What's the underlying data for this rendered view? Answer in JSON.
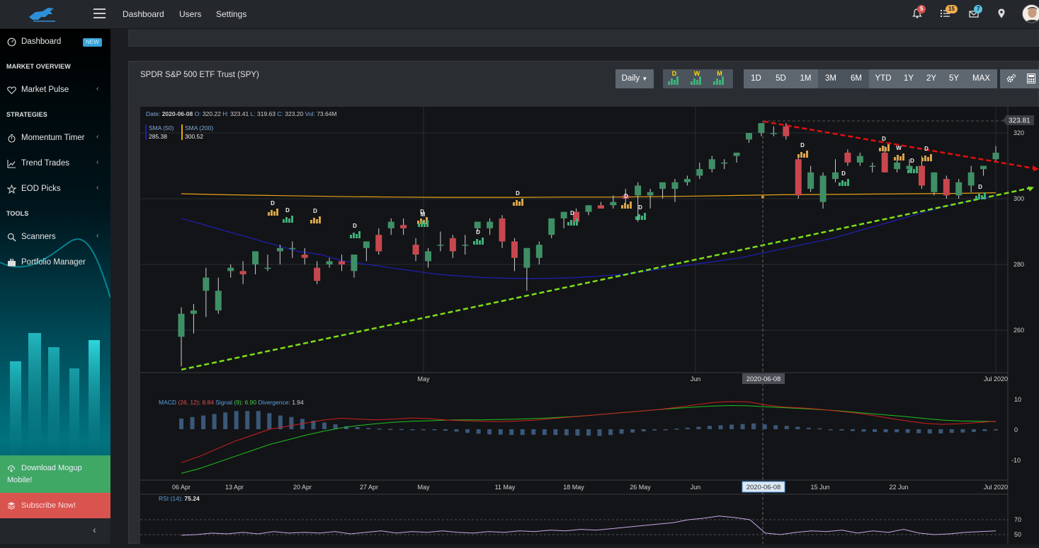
{
  "topbar": {
    "nav": [
      "Dashboard",
      "Users",
      "Settings"
    ],
    "badges": {
      "notifications": "5",
      "tasks": "15",
      "messages": "7"
    },
    "colors": {
      "notifications": "#d9534f",
      "tasks": "#f0ad4e",
      "messages": "#5bc0de"
    }
  },
  "sidebar": {
    "dashboard": "Dashboard",
    "new_badge": "NEW",
    "market_overview": "MARKET OVERVIEW",
    "market_pulse": "Market Pulse",
    "strategies": "STRATEGIES",
    "momentum_timer": "Momentum Timer",
    "trend_trades": "Trend Trades",
    "eod_picks": "EOD Picks",
    "tools": "TOOLS",
    "scanners": "Scanners",
    "portfolio_manager": "Portfolio Manager",
    "download_line1": "Download Mogup",
    "download_line2": "Mobile!",
    "subscribe": "Subscribe Now!"
  },
  "panel": {
    "title": "SPDR S&P 500 ETF Trust (SPY)",
    "interval": "Daily",
    "period_icons": [
      "D",
      "W",
      "M"
    ],
    "ranges": [
      "1D",
      "5D",
      "1M",
      "3M",
      "6M",
      "YTD",
      "1Y",
      "2Y",
      "5Y",
      "MAX"
    ],
    "active_ranges": [
      "3M",
      "6M"
    ]
  },
  "chart": {
    "info": {
      "date_label": "Date:",
      "date": "2020-06-08",
      "o_label": "O:",
      "o": "320.22",
      "h_label": "H:",
      "h": "323.41",
      "l_label": "L:",
      "l": "319.63",
      "c_label": "C:",
      "c": "323.20",
      "vol_label": "Vol:",
      "vol": "73.64M"
    },
    "sma50_label": "SMA (50)",
    "sma50_value": "285.38",
    "sma200_label": "SMA (200)",
    "sma200_value": "300.52",
    "last_price": "323.81",
    "price_ticks": [
      "320",
      "300",
      "280",
      "260"
    ],
    "month_labels": [
      "May",
      "Jun",
      "Jul 2020"
    ],
    "crosshair_date": "2020-06-08",
    "macd": {
      "name": "MACD",
      "params": "(26, 12)",
      "value": "8.84",
      "signal_label": "Signal",
      "signal_params": "(9)",
      "signal_value": "6.90",
      "divergence_label": "Divergence",
      "divergence_value": "1.94",
      "ticks": [
        "10",
        "0",
        "-10"
      ]
    },
    "date_ticks": [
      "06 Apr",
      "13 Apr",
      "20 Apr",
      "27 Apr",
      "May",
      "11 May",
      "18 May",
      "26 May",
      "Jun",
      "15 Jun",
      "22 Jun",
      "Jul 2020"
    ],
    "rsi": {
      "label": "RSI",
      "params": "(14)",
      "value": "75.24",
      "ticks": [
        "70",
        "50"
      ]
    },
    "colors": {
      "up": "#3f8f66",
      "down": "#c8474f",
      "sma50": "#1f1fb8",
      "sma200": "#e8a317",
      "support": "#7be018",
      "resistance": "#e01010"
    }
  },
  "chart_data": {
    "type": "candlestick",
    "symbol": "SPY",
    "interval": "Daily",
    "ylim": [
      248,
      332
    ],
    "candles": [
      {
        "o": 258,
        "h": 267,
        "l": 249,
        "c": 265
      },
      {
        "o": 265,
        "h": 268,
        "l": 259,
        "c": 266
      },
      {
        "o": 272,
        "h": 279,
        "l": 264,
        "c": 276
      },
      {
        "o": 266,
        "h": 276,
        "l": 265,
        "c": 272
      },
      {
        "o": 278,
        "h": 280,
        "l": 276,
        "c": 279
      },
      {
        "o": 278,
        "h": 281,
        "l": 274,
        "c": 277
      },
      {
        "o": 280,
        "h": 284,
        "l": 277,
        "c": 284
      },
      {
        "o": 279,
        "h": 283,
        "l": 278,
        "c": 279
      },
      {
        "o": 284,
        "h": 286,
        "l": 280,
        "c": 285
      },
      {
        "o": 285,
        "h": 287,
        "l": 282,
        "c": 285
      },
      {
        "o": 283,
        "h": 285,
        "l": 280,
        "c": 282
      },
      {
        "o": 279,
        "h": 281,
        "l": 274,
        "c": 275
      },
      {
        "o": 280,
        "h": 282,
        "l": 279,
        "c": 281
      },
      {
        "o": 281,
        "h": 283,
        "l": 278,
        "c": 280
      },
      {
        "o": 278,
        "h": 283,
        "l": 276,
        "c": 283
      },
      {
        "o": 285,
        "h": 287,
        "l": 281,
        "c": 287
      },
      {
        "o": 289,
        "h": 291,
        "l": 283,
        "c": 284
      },
      {
        "o": 291,
        "h": 294,
        "l": 289,
        "c": 293
      },
      {
        "o": 292,
        "h": 294,
        "l": 289,
        "c": 291
      },
      {
        "o": 286,
        "h": 288,
        "l": 281,
        "c": 283
      },
      {
        "o": 281,
        "h": 285,
        "l": 279,
        "c": 284
      },
      {
        "o": 286,
        "h": 290,
        "l": 284,
        "c": 286
      },
      {
        "o": 288,
        "h": 289,
        "l": 282,
        "c": 284
      },
      {
        "o": 286,
        "h": 289,
        "l": 283,
        "c": 286
      },
      {
        "o": 291,
        "h": 293,
        "l": 290,
        "c": 293
      },
      {
        "o": 291,
        "h": 294,
        "l": 289,
        "c": 293
      },
      {
        "o": 294,
        "h": 295,
        "l": 285,
        "c": 287
      },
      {
        "o": 287,
        "h": 288,
        "l": 278,
        "c": 282
      },
      {
        "o": 279,
        "h": 284,
        "l": 272,
        "c": 285
      },
      {
        "o": 282,
        "h": 287,
        "l": 280,
        "c": 286
      },
      {
        "o": 289,
        "h": 294,
        "l": 288,
        "c": 294
      },
      {
        "o": 294,
        "h": 296,
        "l": 291,
        "c": 296
      },
      {
        "o": 296,
        "h": 297,
        "l": 292,
        "c": 293
      },
      {
        "o": 296,
        "h": 298,
        "l": 295,
        "c": 298
      },
      {
        "o": 298,
        "h": 299,
        "l": 297,
        "c": 297
      },
      {
        "o": 298,
        "h": 301,
        "l": 297,
        "c": 299
      },
      {
        "o": 301,
        "h": 303,
        "l": 298,
        "c": 300
      },
      {
        "o": 301,
        "h": 305,
        "l": 293,
        "c": 304
      },
      {
        "o": 301,
        "h": 303,
        "l": 297,
        "c": 302
      },
      {
        "o": 303,
        "h": 304,
        "l": 300,
        "c": 305
      },
      {
        "o": 303,
        "h": 306,
        "l": 299,
        "c": 305
      },
      {
        "o": 305,
        "h": 307,
        "l": 304,
        "c": 306
      },
      {
        "o": 307,
        "h": 311,
        "l": 306,
        "c": 309
      },
      {
        "o": 309,
        "h": 313,
        "l": 308,
        "c": 312
      },
      {
        "o": 311,
        "h": 312,
        "l": 309,
        "c": 311
      },
      {
        "o": 313,
        "h": 314,
        "l": 311,
        "c": 314
      },
      {
        "o": 318,
        "h": 320,
        "l": 317,
        "c": 320
      },
      {
        "o": 320,
        "h": 323,
        "l": 319,
        "c": 323
      },
      {
        "o": 320,
        "h": 322,
        "l": 319,
        "c": 320
      },
      {
        "o": 322,
        "h": 323,
        "l": 318,
        "c": 319
      },
      {
        "o": 312,
        "h": 313,
        "l": 300,
        "c": 301
      },
      {
        "o": 303,
        "h": 310,
        "l": 302,
        "c": 308
      },
      {
        "o": 299,
        "h": 308,
        "l": 297,
        "c": 307
      },
      {
        "o": 306,
        "h": 312,
        "l": 305,
        "c": 308
      },
      {
        "o": 314,
        "h": 315,
        "l": 310,
        "c": 311
      },
      {
        "o": 311,
        "h": 314,
        "l": 310,
        "c": 313
      },
      {
        "o": 310,
        "h": 311,
        "l": 308,
        "c": 310
      },
      {
        "o": 314,
        "h": 316,
        "l": 308,
        "c": 308
      },
      {
        "o": 309,
        "h": 313,
        "l": 308,
        "c": 311
      },
      {
        "o": 309,
        "h": 312,
        "l": 308,
        "c": 310
      },
      {
        "o": 310,
        "h": 313,
        "l": 303,
        "c": 304
      },
      {
        "o": 302,
        "h": 308,
        "l": 301,
        "c": 308
      },
      {
        "o": 306,
        "h": 307,
        "l": 300,
        "c": 301
      },
      {
        "o": 301,
        "h": 306,
        "l": 300,
        "c": 305
      },
      {
        "o": 304,
        "h": 310,
        "l": 302,
        "c": 308
      },
      {
        "o": 309,
        "h": 310,
        "l": 307,
        "c": 310
      },
      {
        "o": 312,
        "h": 316,
        "l": 311,
        "c": 314
      }
    ],
    "sma50": [
      294,
      292,
      290,
      288,
      286,
      284,
      283,
      281,
      280,
      279,
      278,
      277,
      276.5,
      276,
      275.8,
      275.7,
      275.8,
      276,
      276.5,
      277,
      278,
      279,
      280,
      281,
      282,
      283.5,
      285,
      286.5,
      288,
      290,
      292,
      294,
      296,
      298,
      299.5,
      301
    ],
    "sma200": [
      301.5,
      301.2,
      301,
      300.8,
      300.6,
      300.5,
      300.4,
      300.4,
      300.4,
      300.5,
      300.5,
      300.6,
      300.8,
      301,
      301.2,
      301.3,
      301.4,
      301.5,
      301.6,
      301.8
    ],
    "support_line": {
      "from": 248,
      "to": 303.5
    },
    "resistance_line": {
      "from": 323.5,
      "to": 309
    },
    "macd": {
      "macd_line": [
        -11,
        -9,
        -6.5,
        -4,
        -2,
        0,
        1,
        2,
        3,
        3.6,
        3.3,
        3.1,
        3.3,
        3.7,
        3.5,
        3,
        2.8,
        2.6,
        2.5,
        2.7,
        3,
        3.5,
        4,
        4.5,
        5,
        5.5,
        6,
        6.5,
        7.2,
        8,
        8.8,
        9.1,
        9,
        8,
        7.3,
        7,
        6.6,
        6,
        5.4,
        4.6,
        3.6,
        2.7,
        1.9,
        1.6,
        1.8,
        2.2,
        2.6
      ],
      "signal_line": [
        -14.5,
        -13,
        -11,
        -9,
        -7,
        -5,
        -3.5,
        -2,
        -0.7,
        0.4,
        1.2,
        1.8,
        2.3,
        2.6,
        2.8,
        3,
        3.1,
        3.1,
        3.2,
        3.3,
        3.5,
        3.8,
        4.1,
        4.5,
        5,
        5.5,
        6,
        6.5,
        6.9,
        7.3,
        7.6,
        7.8,
        7.7,
        7.4,
        7.1,
        6.8,
        6.5,
        6.1,
        5.6,
        5.1,
        4.6,
        4.1,
        3.5,
        3,
        2.7,
        2.6,
        2.5
      ],
      "histogram": [
        3.5,
        4,
        4.5,
        5,
        5.5,
        6,
        6,
        6,
        5.3,
        4.5,
        4,
        3.4,
        2.8,
        2.2,
        1.6,
        1,
        0.7,
        0.4,
        0.2,
        0.1,
        0.05,
        0,
        -0.1,
        -0.3,
        -0.5,
        -0.8,
        -1.2,
        -1.5,
        -1.7,
        -1.8,
        -1.9,
        -1.9,
        -1.8,
        -1.9,
        -1.9,
        -2,
        -2.1,
        -2.1,
        -2.2,
        -1.9,
        -1.5,
        -1.1,
        -0.7,
        -0.4,
        -0.1,
        0.2,
        0.5,
        0.8,
        1.1,
        1.3,
        1.5,
        1.7,
        1.9,
        1.6,
        1.3,
        1.1,
        0.8,
        0.5,
        0.3,
        -0.2,
        -0.4,
        -0.6,
        -0.8,
        -0.9,
        -1,
        -1,
        -1.2,
        -1.3,
        -1.4,
        -1.4,
        -1.2,
        -1.1,
        -0.9,
        -0.6,
        -0.4
      ]
    },
    "rsi": [
      49,
      50,
      52,
      51,
      53,
      51,
      54,
      52,
      53,
      52,
      54,
      51,
      53,
      55,
      52,
      54,
      53,
      55,
      53,
      52,
      54,
      53,
      55,
      54,
      56,
      55,
      57,
      56,
      58,
      60,
      62,
      64,
      66,
      70,
      72,
      75,
      73,
      70,
      52,
      50,
      53,
      55,
      54,
      56,
      52,
      55,
      53,
      57,
      52,
      50,
      51,
      53,
      54,
      55
    ]
  }
}
